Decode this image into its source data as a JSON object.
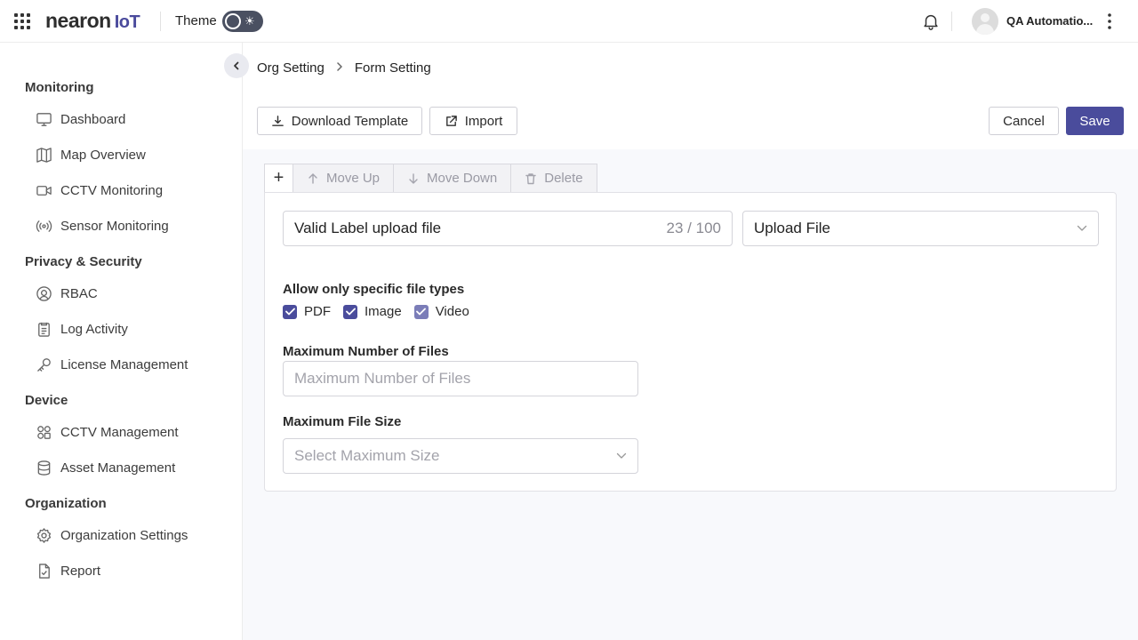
{
  "header": {
    "logo_main": "nearon",
    "logo_suffix": "IoT",
    "theme_label": "Theme",
    "user_name": "QA Automatio..."
  },
  "sidebar": {
    "sections": [
      {
        "title": "Monitoring",
        "items": [
          {
            "label": "Dashboard",
            "icon": "monitor-icon"
          },
          {
            "label": "Map Overview",
            "icon": "map-icon"
          },
          {
            "label": "CCTV Monitoring",
            "icon": "video-icon"
          },
          {
            "label": "Sensor Monitoring",
            "icon": "sensor-icon"
          }
        ]
      },
      {
        "title": "Privacy & Security",
        "items": [
          {
            "label": "RBAC",
            "icon": "rbac-icon"
          },
          {
            "label": "Log Activity",
            "icon": "log-icon"
          },
          {
            "label": "License Management",
            "icon": "key-icon"
          }
        ]
      },
      {
        "title": "Device",
        "items": [
          {
            "label": "CCTV Management",
            "icon": "grid-icon"
          },
          {
            "label": "Asset Management",
            "icon": "database-icon"
          }
        ]
      },
      {
        "title": "Organization",
        "items": [
          {
            "label": "Organization Settings",
            "icon": "gear-icon"
          },
          {
            "label": "Report",
            "icon": "report-icon"
          }
        ]
      }
    ]
  },
  "breadcrumb": {
    "parent": "Org Setting",
    "current": "Form Setting"
  },
  "actions": {
    "download_template": "Download Template",
    "import": "Import",
    "cancel": "Cancel",
    "save": "Save"
  },
  "toolbar": {
    "add": "+",
    "move_up": "Move Up",
    "move_down": "Move Down",
    "delete": "Delete"
  },
  "form": {
    "label_value": "Valid Label upload file",
    "label_counter": "23 / 100",
    "field_type": "Upload File",
    "file_types_title": "Allow only specific file types",
    "file_types": [
      {
        "label": "PDF",
        "checked": true
      },
      {
        "label": "Image",
        "checked": true
      },
      {
        "label": "Video",
        "checked": true
      }
    ],
    "max_files_title": "Maximum Number of Files",
    "max_files_placeholder": "Maximum Number of Files",
    "max_size_title": "Maximum File Size",
    "max_size_placeholder": "Select Maximum Size"
  },
  "colors": {
    "primary": "#4a4c9c",
    "content_bg": "#f8f9fc"
  }
}
